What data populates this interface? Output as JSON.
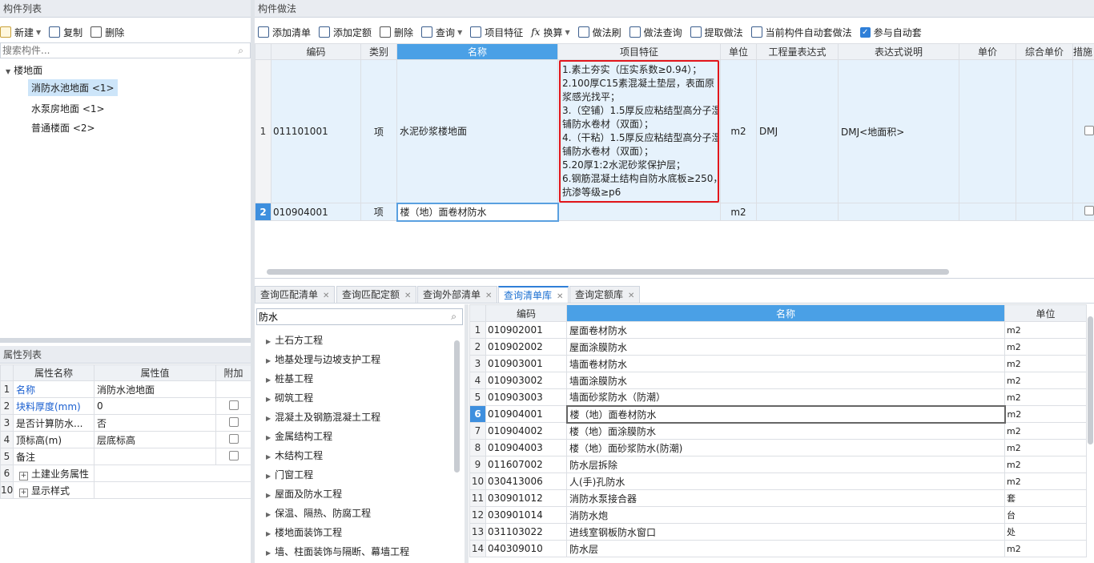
{
  "left_panel": {
    "title": "构件列表",
    "toolbar": {
      "new": "新建",
      "copy": "复制",
      "delete": "删除"
    },
    "search_placeholder": "搜索构件...",
    "tree": {
      "root": "楼地面",
      "items": [
        "消防水池地面 <1>",
        "水泵房地面 <1>",
        "普通楼面 <2>"
      ]
    }
  },
  "props": {
    "title": "属性列表",
    "headers": [
      "属性名称",
      "属性值",
      "附加"
    ],
    "rows": [
      {
        "n": "1",
        "name": "名称",
        "value": "消防水池地面",
        "blue": true,
        "check": false
      },
      {
        "n": "2",
        "name": "块料厚度(mm)",
        "value": "0",
        "blue": true,
        "check": true
      },
      {
        "n": "3",
        "name": "是否计算防水...",
        "value": "否",
        "blue": false,
        "check": true
      },
      {
        "n": "4",
        "name": "顶标高(m)",
        "value": "层底标高",
        "blue": false,
        "check": true
      },
      {
        "n": "5",
        "name": "备注",
        "value": "",
        "blue": false,
        "check": true
      },
      {
        "n": "6",
        "name": "土建业务属性",
        "value": "",
        "blue": false,
        "check": false,
        "expand": true
      },
      {
        "n": "10",
        "name": "显示样式",
        "value": "",
        "blue": false,
        "check": false,
        "expand": true
      }
    ]
  },
  "method": {
    "title": "构件做法",
    "toolbar": {
      "add_list": "添加清单",
      "add_quota": "添加定额",
      "delete": "删除",
      "query": "查询",
      "item_feature": "项目特征",
      "convert": "换算",
      "method_brush": "做法刷",
      "method_query": "做法查询",
      "extract": "提取做法",
      "auto_method": "当前构件自动套做法",
      "auto_join": "参与自动套"
    },
    "headers": [
      "编码",
      "类别",
      "名称",
      "项目特征",
      "单位",
      "工程量表达式",
      "表达式说明",
      "单价",
      "综合单价",
      "措施"
    ],
    "rows": [
      {
        "n": "1",
        "code": "011101001",
        "type": "项",
        "name": "水泥砂浆楼地面",
        "feature_lines": [
          "1.素土夯实（压实系数≥0.94）；",
          "2.100厚C15素混凝土垫层，表面原",
          "浆感光找平；",
          "3.（空铺）1.5厚反应粘结型高分子湿",
          "铺防水卷材（双面）；",
          "4.（干粘）1.5厚反应粘结型高分子湿",
          "铺防水卷材（双面）；",
          "5.20厚1:2水泥砂浆保护层；",
          "6.钢筋混凝土结构自防水底板≥250，",
          "抗渗等级≥p6"
        ],
        "unit": "m2",
        "expr": "DMJ",
        "expr_desc": "DMJ<地面积>"
      },
      {
        "n": "2",
        "code": "010904001",
        "type": "项",
        "name": "楼（地）面卷材防水",
        "unit": "m2"
      }
    ]
  },
  "tabs": [
    "查询匹配清单",
    "查询匹配定额",
    "查询外部清单",
    "查询清单库",
    "查询定额库"
  ],
  "library": {
    "search_value": "防水",
    "categories": [
      "土石方工程",
      "地基处理与边坡支护工程",
      "桩基工程",
      "砌筑工程",
      "混凝土及钢筋混凝土工程",
      "金属结构工程",
      "木结构工程",
      "门窗工程",
      "屋面及防水工程",
      "保温、隔热、防腐工程",
      "楼地面装饰工程",
      "墙、柱面装饰与隔断、幕墙工程"
    ],
    "headers": [
      "编码",
      "名称",
      "单位"
    ],
    "rows": [
      {
        "n": "1",
        "code": "010902001",
        "name": "屋面卷材防水",
        "unit": "m2"
      },
      {
        "n": "2",
        "code": "010902002",
        "name": "屋面涂膜防水",
        "unit": "m2"
      },
      {
        "n": "3",
        "code": "010903001",
        "name": "墙面卷材防水",
        "unit": "m2"
      },
      {
        "n": "4",
        "code": "010903002",
        "name": "墙面涂膜防水",
        "unit": "m2"
      },
      {
        "n": "5",
        "code": "010903003",
        "name": "墙面砂浆防水（防潮）",
        "unit": "m2"
      },
      {
        "n": "6",
        "code": "010904001",
        "name": "楼（地）面卷材防水",
        "unit": "m2"
      },
      {
        "n": "7",
        "code": "010904002",
        "name": "楼（地）面涂膜防水",
        "unit": "m2"
      },
      {
        "n": "8",
        "code": "010904003",
        "name": "楼（地）面砂浆防水(防潮)",
        "unit": "m2"
      },
      {
        "n": "9",
        "code": "011607002",
        "name": "防水层拆除",
        "unit": "m2"
      },
      {
        "n": "10",
        "code": "030413006",
        "name": "人(手)孔防水",
        "unit": "m2"
      },
      {
        "n": "11",
        "code": "030901012",
        "name": "消防水泵接合器",
        "unit": "套"
      },
      {
        "n": "12",
        "code": "030901014",
        "name": "消防水炮",
        "unit": "台"
      },
      {
        "n": "13",
        "code": "031103022",
        "name": "进线室钢板防水窗口",
        "unit": "处"
      },
      {
        "n": "14",
        "code": "040309010",
        "name": "防水层",
        "unit": "m2"
      }
    ]
  }
}
